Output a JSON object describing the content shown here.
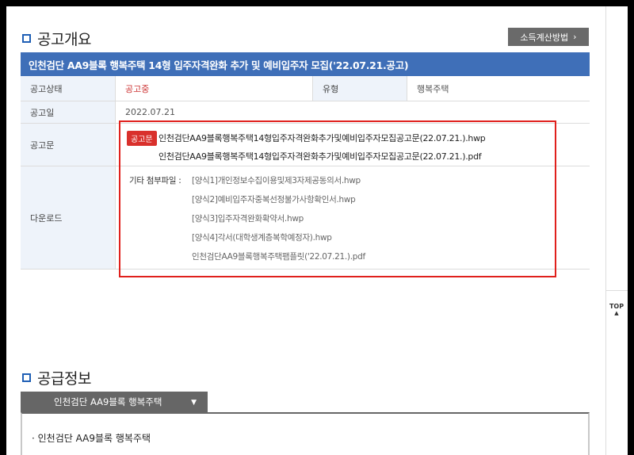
{
  "overview": {
    "section_title": "공고개요",
    "calc_button": "소득계산방법",
    "calc_button_icon": "chevron-right-icon",
    "banner_title": "인천검단 AA9블록 행복주택 14형 입주자격완화 추가 및 예비입주자 모집('22.07.21.공고)",
    "rows": {
      "status_label": "공고상태",
      "status_value": "공고중",
      "type_label": "유형",
      "type_value": "행복주택",
      "date_label": "공고일",
      "date_value": "2022.07.21",
      "notice_label": "공고문",
      "download_label": "다운로드"
    },
    "notice_badge": "공고문",
    "notice_files": [
      "인천검단AA9블록행복주택14형입주자격완화추가및예비입주자모집공고문(22.07.21.).hwp",
      "인천검단AA9블록행복주택14형입주자격완화추가및예비입주자모집공고문(22.07.21.).pdf"
    ],
    "attachment_label": "기타 첨부파일 :",
    "attachments": [
      "[양식1]개인정보수집이용및제3자제공동의서.hwp",
      "[양식2]예비입주자중복선정불가사항확인서.hwp",
      "[양식3]입주자격완화확약서.hwp",
      "[양식4]각서(대학생계층복학예정자).hwp",
      "인천검단AA9블록행복주택팸플릿('22.07.21.).pdf"
    ]
  },
  "supply": {
    "section_title": "공급정보",
    "tab_label": "인천검단 AA9블록 행복주택",
    "tab_icon": "caret-down-icon",
    "item": "· 인천검단 AA9블록 행복주택"
  },
  "sidebar": {
    "top_label": "TOP",
    "top_icon": "up-arrow-icon"
  },
  "colors": {
    "accent_blue": "#3f6fb8",
    "highlight_red": "#e0201c",
    "status_red": "#c33333"
  }
}
